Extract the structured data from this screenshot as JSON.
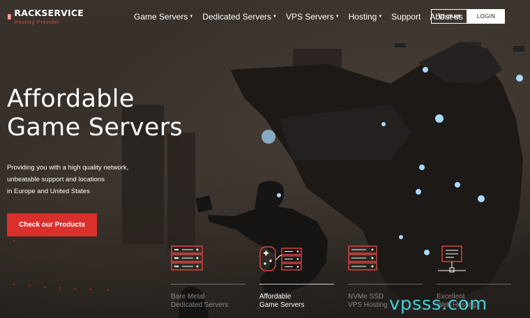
{
  "logo": {
    "name": "RACKSERVICE",
    "tagline": "Hosting Provider"
  },
  "nav": [
    {
      "label": "Game Servers",
      "dropdown": true
    },
    {
      "label": "Dedicated Servers",
      "dropdown": true
    },
    {
      "label": "VPS Servers",
      "dropdown": true
    },
    {
      "label": "Hosting",
      "dropdown": true
    },
    {
      "label": "Support",
      "dropdown": false
    },
    {
      "label": "About us",
      "dropdown": false
    }
  ],
  "cart_label": "CART",
  "login_label": "LOGIN",
  "hero": {
    "title_line1": "Affordable",
    "title_line2": "Game Servers",
    "desc_line1": "Providing you with a high quality network,",
    "desc_line2": "unbeatable support and locations",
    "desc_line3": "in Europe and United States",
    "cta": "Check our Products"
  },
  "products": [
    {
      "line1": "Bare Metal",
      "line2": "Dedicated Servers",
      "active": false,
      "icon": "server-rack-icon"
    },
    {
      "line1": "Affordable",
      "line2": "Game Servers",
      "active": true,
      "icon": "gamepad-server-icon"
    },
    {
      "line1": "NVMe SSD",
      "line2": "VPS Hosting",
      "active": false,
      "icon": "server-stack-icon"
    },
    {
      "line1": "Excellent",
      "line2": "Web Hosting",
      "active": false,
      "icon": "monitor-network-icon"
    }
  ],
  "watermark": "vpsss.com",
  "colors": {
    "accent": "#d9302c",
    "watermark": "#3fd0d8",
    "icon_red": "#e2463f"
  }
}
